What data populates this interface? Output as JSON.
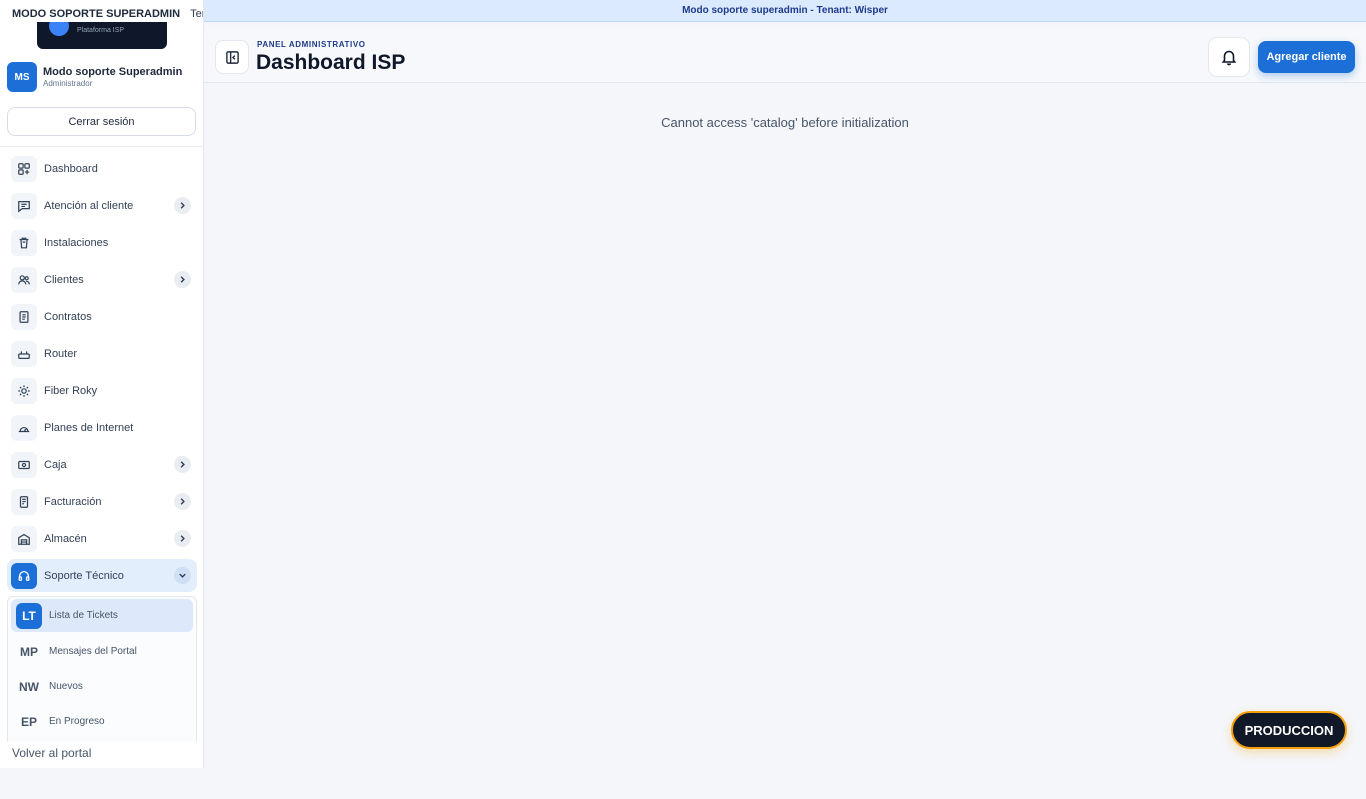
{
  "sidebar": {
    "top_mode": "MODO SOPORTE SUPERADMIN",
    "top_tenant": "Tenant",
    "logo_text": "Plataforma ISP",
    "user": {
      "initials": "MS",
      "name": "Modo soporte Superadmin",
      "role": "Administrador"
    },
    "logout_label": "Cerrar sesión",
    "items": [
      {
        "label": "Dashboard",
        "icon": "grid-icon",
        "has_chevron": false
      },
      {
        "label": "Atención al cliente",
        "icon": "chat-icon",
        "has_chevron": true
      },
      {
        "label": "Instalaciones",
        "icon": "trash-icon",
        "has_chevron": false
      },
      {
        "label": "Clientes",
        "icon": "users-icon",
        "has_chevron": true
      },
      {
        "label": "Contratos",
        "icon": "document-icon",
        "has_chevron": false
      },
      {
        "label": "Router",
        "icon": "router-icon",
        "has_chevron": false
      },
      {
        "label": "Fiber Roky",
        "icon": "sun-icon",
        "has_chevron": false
      },
      {
        "label": "Planes de Internet",
        "icon": "speed-icon",
        "has_chevron": false
      },
      {
        "label": "Caja",
        "icon": "cash-icon",
        "has_chevron": true
      },
      {
        "label": "Facturación",
        "icon": "invoice-icon",
        "has_chevron": true
      },
      {
        "label": "Almacén",
        "icon": "warehouse-icon",
        "has_chevron": true
      },
      {
        "label": "Soporte Técnico",
        "icon": "headset-icon",
        "has_chevron": true,
        "expanded": true,
        "active": true
      }
    ],
    "submenu": [
      {
        "abbr": "LT",
        "label": "Lista de Tickets",
        "active": true
      },
      {
        "abbr": "MP",
        "label": "Mensajes del Portal"
      },
      {
        "abbr": "NW",
        "label": "Nuevos"
      },
      {
        "abbr": "EP",
        "label": "En Progreso"
      }
    ],
    "back_label": "Volver al portal"
  },
  "banner": {
    "text": "Modo soporte superadmin - Tenant: Wisper"
  },
  "header": {
    "eyebrow": "PANEL ADMINISTRATIVO",
    "title": "Dashboard ISP",
    "add_client_label": "Agregar cliente"
  },
  "main": {
    "error_message": "Cannot access 'catalog' before initialization"
  },
  "env_badge": "PRODUCCION",
  "colors": {
    "primary": "#1d6fd8",
    "banner_bg": "#dbeafe",
    "badge_border": "#f59e0b",
    "dark": "#111827"
  }
}
